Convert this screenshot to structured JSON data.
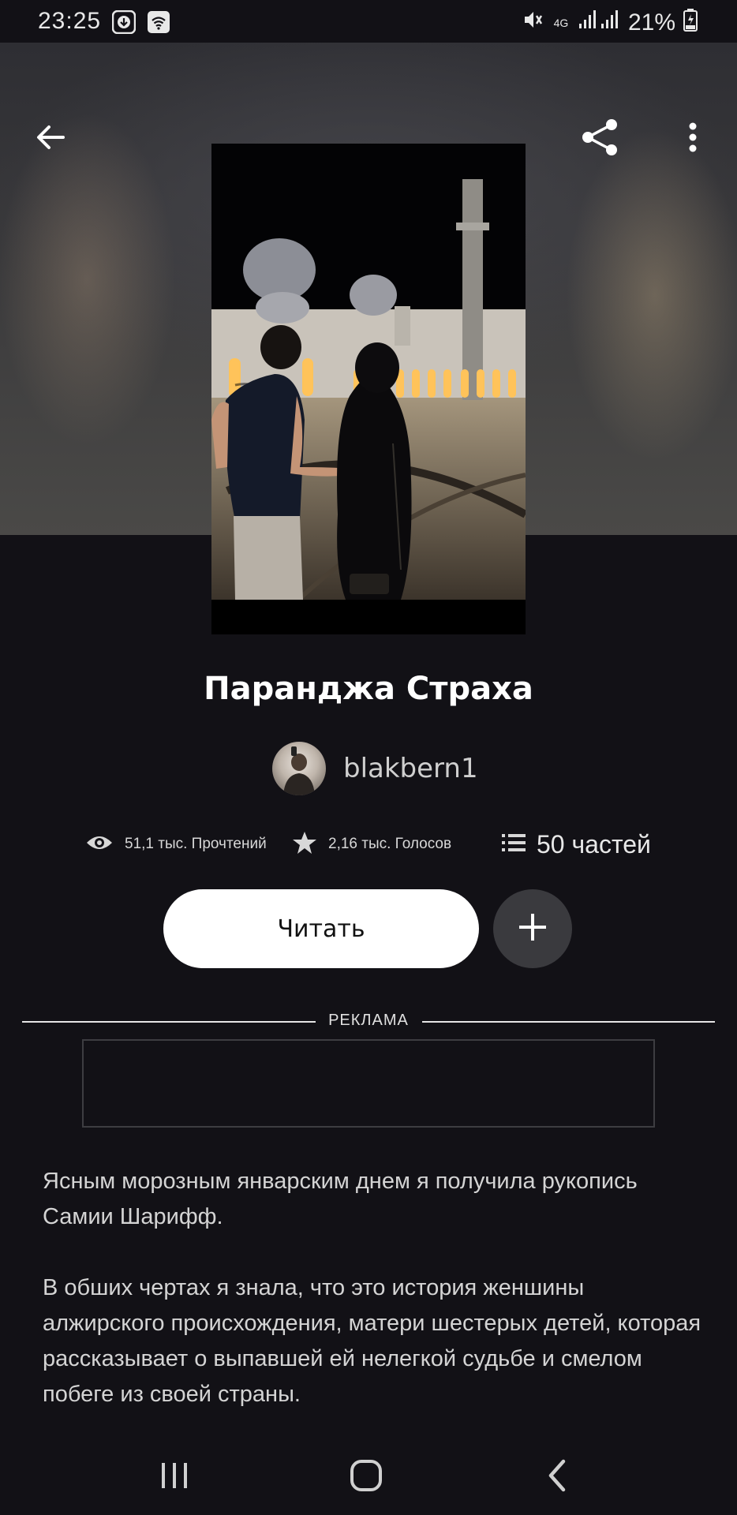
{
  "status_bar": {
    "time": "23:25",
    "battery": "21%",
    "network": "4G",
    "icons": [
      "download-icon",
      "wifi-icon",
      "mute-icon",
      "signal-icon",
      "battery-icon"
    ]
  },
  "toolbar": {
    "icons": [
      "back-arrow-icon",
      "share-icon",
      "more-vertical-icon"
    ]
  },
  "story": {
    "title": "Паранджа Страха",
    "author": "blakbern1",
    "reads": "51,1 тыс. Прочтений",
    "votes": "2,16 тыс. Голосов",
    "parts": "50 частей",
    "read_button": "Читать",
    "description": [
      "Ясным морозным январским днем я получила рукопись Самии Шарифф.",
      "В обших чертах я знала, что это история женшины алжирского происхождения, матери шестерых детей, которая рассказывает о выпавшей ей нелегкой судьбе и смелом побеге из своей страны."
    ]
  },
  "ad": {
    "label": "РЕКЛАМА"
  },
  "colors": {
    "background": "#121116",
    "button_light": "#ffffff",
    "button_dark": "#3a3a3e"
  }
}
